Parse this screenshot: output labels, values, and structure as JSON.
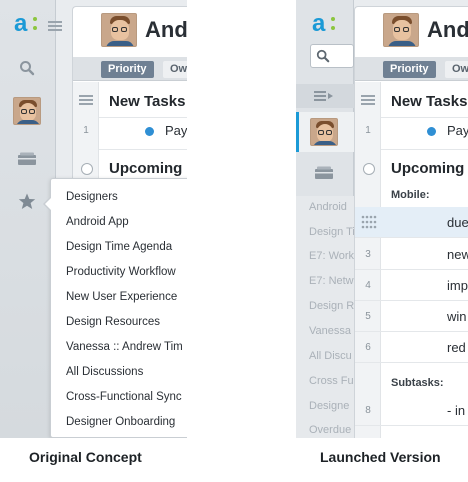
{
  "captions": {
    "original": "Original Concept",
    "launched": "Launched Version"
  },
  "original": {
    "user_name_partial": "Andr",
    "tabs": [
      "Priority",
      "Ow"
    ],
    "sections": {
      "new_tasks": "New Tasks",
      "upcoming": "Upcoming"
    },
    "rows": [
      {
        "num": "1",
        "text": "Pay"
      }
    ],
    "menu_items": [
      "Designers",
      "Android App",
      "Design Time Agenda",
      "Productivity Workflow",
      "New User Experience",
      "Design Resources",
      "Vanessa :: Andrew Tim",
      "All Discussions",
      "Cross-Functional Sync",
      "Designer Onboarding"
    ]
  },
  "launched": {
    "user_name_partial": "And",
    "tabs": [
      "Priority",
      "Ow"
    ],
    "sections": {
      "new_tasks": "New Tasks",
      "upcoming": "Upcoming",
      "mobile": "Mobile:",
      "subtasks": "Subtasks:"
    },
    "rows_top": [
      {
        "num": "1",
        "text": "Pay"
      }
    ],
    "mobile_rows": [
      {
        "num": "",
        "text": "due"
      },
      {
        "num": "3",
        "text": "new"
      },
      {
        "num": "4",
        "text": "imp"
      },
      {
        "num": "5",
        "text": "win"
      },
      {
        "num": "6",
        "text": "red"
      }
    ],
    "subtask_rows": [
      {
        "num": "8",
        "text": "- in"
      }
    ],
    "sidebar_faded": [
      "Android",
      "Design Ti",
      "E7: Work",
      "E7: Netw",
      "Design R",
      "Vanessa",
      "All Discu",
      "Cross Fu",
      "Designe",
      "Overdue"
    ]
  },
  "colors": {
    "brand_blue": "#1b9ad6",
    "brand_green": "#8cc63f",
    "active_tab": "#6f8093",
    "bullet_blue": "#2f8fd4"
  }
}
